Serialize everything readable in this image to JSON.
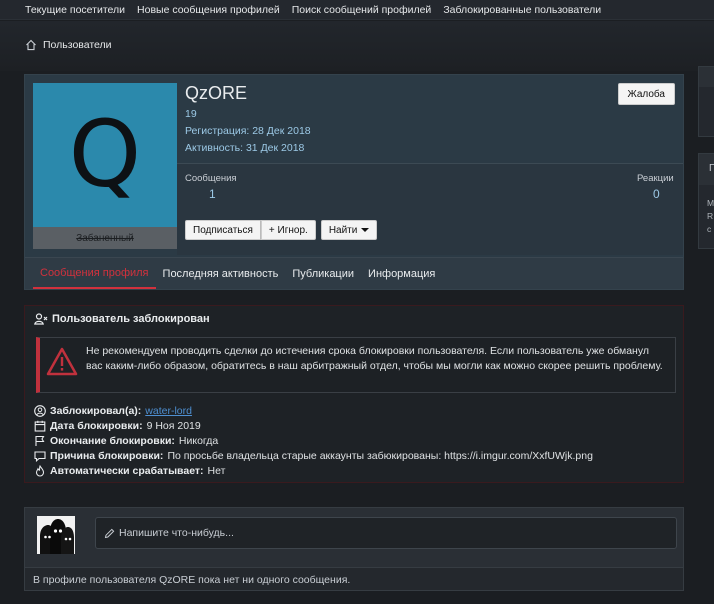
{
  "topnav": {
    "items": [
      "Текущие посетители",
      "Новые сообщения профилей",
      "Поиск сообщений профилей",
      "Заблокированные пользователи"
    ]
  },
  "breadcrumb": {
    "label": "Пользователи",
    "icon": "home-icon"
  },
  "profile": {
    "avatar_letter": "Q",
    "avatar_color": "#2b89ac",
    "banned_label": "Забаненный",
    "username": "QzORE",
    "title_number": "19",
    "registered": "Регистрация: 28 Дек 2018",
    "activity": "Активность: 31 Дек 2018",
    "report_label": "Жалоба",
    "stats": {
      "messages_label": "Сообщения",
      "messages_value": "1",
      "reactions_label": "Реакции",
      "reactions_value": "0"
    },
    "buttons": {
      "subscribe": "Подписаться",
      "ignore": "+ Игнор.",
      "find": "Найти"
    },
    "tabs": [
      "Сообщения профиля",
      "Последняя активность",
      "Публикации",
      "Информация"
    ],
    "active_tab": 0,
    "accent_color": "#d2313d"
  },
  "sidebar": {
    "block2_header": "П",
    "block2_lines": [
      "М",
      "R",
      "с"
    ]
  },
  "ban": {
    "title": "Пользователь заблокирован",
    "warning": "Не рекомендуем проводить сделки до истечения срока блокировки пользователя. Если пользователь уже обманул вас каким-либо образом, обратитесь в наш арбитражный отдел, чтобы мы могли как можно скорее решить проблему.",
    "banned_by_label": "Заблокировал(а):",
    "banned_by_value": "water-lord",
    "date_label": "Дата блокировки:",
    "date_value": "9 Ноя 2019",
    "end_label": "Окончание блокировки:",
    "end_value": "Никогда",
    "reason_label": "Причина блокировки:",
    "reason_value": "По просьбе владельца старые аккаунты забюкированы: https://i.imgur.com/XxfUWjk.png",
    "auto_label": "Автоматически срабатывает:",
    "auto_value": "Нет"
  },
  "post": {
    "placeholder": "Напишите что-нибудь...",
    "empty_text": "В профиле пользователя QzORE пока нет ни одного сообщения."
  }
}
